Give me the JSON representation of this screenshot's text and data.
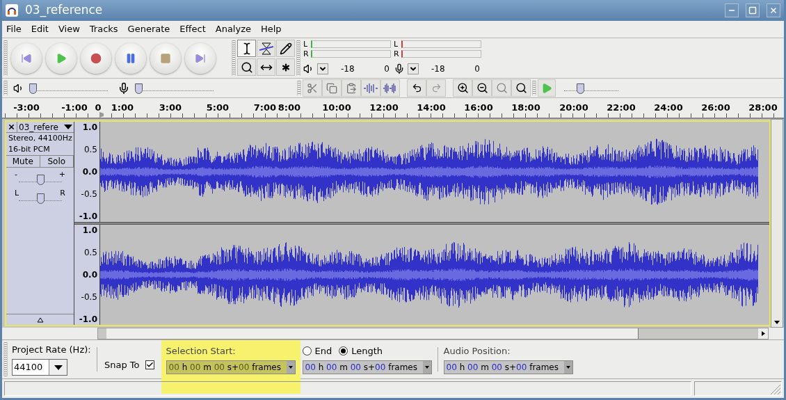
{
  "window": {
    "title": "03_reference"
  },
  "menu": [
    {
      "label": "File"
    },
    {
      "label": "Edit"
    },
    {
      "label": "View"
    },
    {
      "label": "Tracks"
    },
    {
      "label": "Generate"
    },
    {
      "label": "Effect"
    },
    {
      "label": "Analyze"
    },
    {
      "label": "Help"
    }
  ],
  "tools": [
    {
      "kind": "selection",
      "selected": true
    },
    {
      "kind": "envelope",
      "selected": false
    },
    {
      "kind": "draw",
      "selected": false
    },
    {
      "kind": "zoom",
      "selected": false
    },
    {
      "kind": "timeshift",
      "selected": false
    },
    {
      "kind": "multi",
      "selected": false
    }
  ],
  "meters": [
    {
      "kind": "playback",
      "channels": [
        "L",
        "R"
      ],
      "scale": [
        "-18",
        "0"
      ]
    },
    {
      "kind": "record",
      "channels": [
        "L",
        "R"
      ],
      "scale": [
        "-18",
        "0"
      ]
    }
  ],
  "mixer": {
    "playback_volume": {
      "level": 0.0
    },
    "record_volume": {
      "level": 0.0
    }
  },
  "play_at_speed": {
    "level": 0.3
  },
  "ruler": {
    "labels": [
      "-3:00",
      "-1:00",
      "0",
      "1:00",
      "3:00",
      "5:00",
      "7:00",
      "8:00",
      "10:00",
      "12:00",
      "14:00",
      "16:00",
      "18:00",
      "20:00",
      "22:00",
      "24:00",
      "26:00",
      "28:00"
    ]
  },
  "track": {
    "name": "03_refere",
    "info": [
      "Stereo, 44100Hz",
      "16-bit PCM"
    ],
    "buttons": [
      "Mute",
      "Solo"
    ],
    "gain": {
      "min_label": "-",
      "max_label": "+",
      "level": 0.5
    },
    "pan": {
      "min_label": "L",
      "max_label": "R",
      "level": 0.5
    },
    "channels": [
      {
        "scale": [
          "1.0",
          "0.5",
          "0.0",
          "-0.5",
          "-1.0"
        ]
      },
      {
        "scale": [
          "1.0",
          "0.5",
          "0.0",
          "-0.5",
          "-1.0"
        ]
      }
    ]
  },
  "selection_bar": {
    "rate_label": "Project Rate (Hz):",
    "rate": "44100",
    "snap_label": "Snap To",
    "snap": true,
    "start_label": "Selection Start:",
    "start_highlighted": true,
    "start_value": "00 h 00 m 00 s+00 frames",
    "end_options": [
      {
        "label": "End",
        "selected": false
      },
      {
        "label": "Length",
        "selected": true
      }
    ],
    "end_value": "00 h 00 m 00 s+00 frames",
    "position_label": "Audio Position:",
    "position_value": "00 h 00 m 00 s+00 frames"
  }
}
